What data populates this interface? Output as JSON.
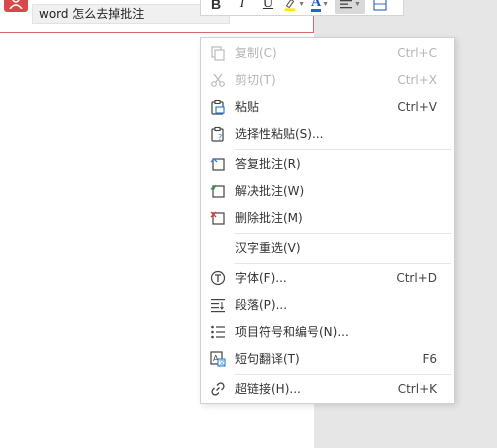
{
  "comment": {
    "text": "word 怎么去掉批注"
  },
  "toolbar": {
    "bold": "B",
    "italic": "I",
    "underline": "U",
    "font_color": "A"
  },
  "menu": {
    "items": [
      {
        "label": "复制(C)",
        "shortcut": "Ctrl+C",
        "icon": "copy-icon",
        "disabled": true
      },
      {
        "label": "剪切(T)",
        "shortcut": "Ctrl+X",
        "icon": "scissors-icon",
        "disabled": true
      },
      {
        "label": "粘贴",
        "shortcut": "Ctrl+V",
        "icon": "paste-icon",
        "disabled": false
      },
      {
        "label": "选择性粘贴(S)...",
        "shortcut": "",
        "icon": "paste-special-icon",
        "disabled": false
      },
      {
        "label": "答复批注(R)",
        "shortcut": "",
        "icon": "reply-comment-icon",
        "disabled": false
      },
      {
        "label": "解决批注(W)",
        "shortcut": "",
        "icon": "resolve-comment-icon",
        "disabled": false
      },
      {
        "label": "删除批注(M)",
        "shortcut": "",
        "icon": "delete-comment-icon",
        "disabled": false
      },
      {
        "label": "汉字重选(V)",
        "shortcut": "",
        "icon": "",
        "disabled": false
      },
      {
        "label": "字体(F)...",
        "shortcut": "Ctrl+D",
        "icon": "font-icon",
        "disabled": false
      },
      {
        "label": "段落(P)...",
        "shortcut": "",
        "icon": "paragraph-icon",
        "disabled": false
      },
      {
        "label": "项目符号和编号(N)...",
        "shortcut": "",
        "icon": "bullets-icon",
        "disabled": false
      },
      {
        "label": "短句翻译(T)",
        "shortcut": "F6",
        "icon": "translate-icon",
        "disabled": false
      },
      {
        "label": "超链接(H)...",
        "shortcut": "Ctrl+K",
        "icon": "link-icon",
        "disabled": false
      }
    ]
  }
}
